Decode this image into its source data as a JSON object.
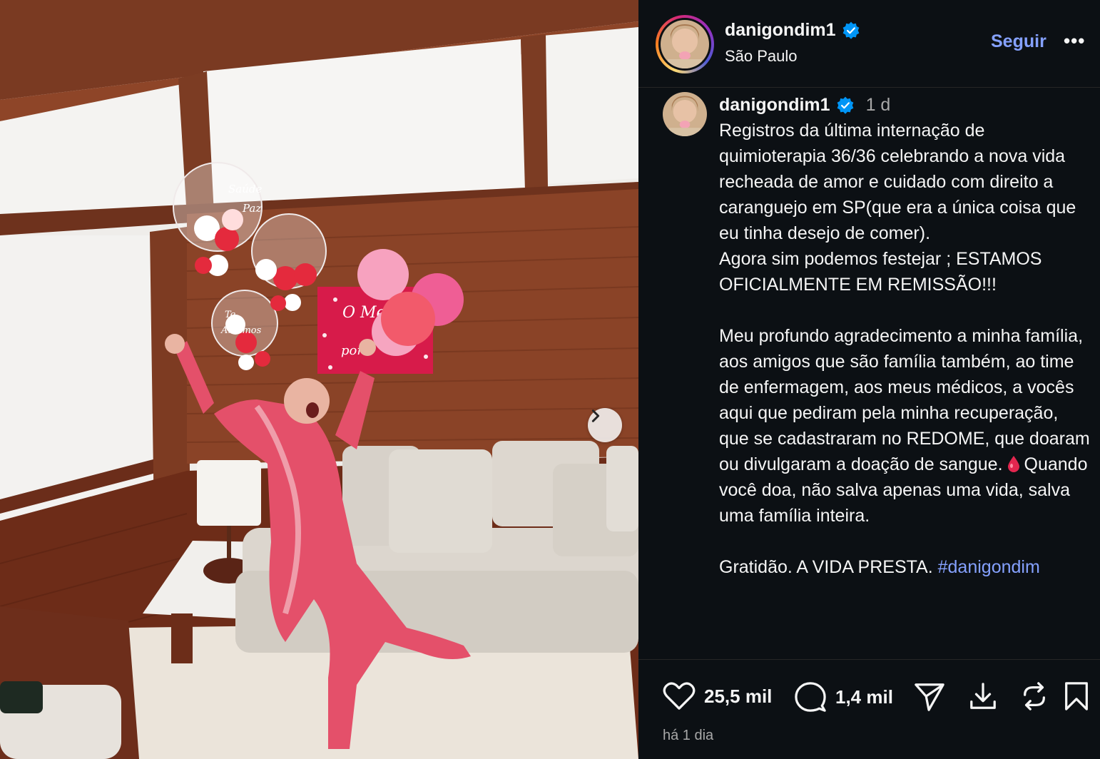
{
  "post": {
    "username": "danigondim1",
    "verified": true,
    "location": "São Paulo",
    "follow_label": "Seguir",
    "more_label": "•••",
    "caption": {
      "username": "danigondim1",
      "time": "1 d",
      "paragraph1": "Registros da última internação de quimioterapia 36/36 celebrando a nova vida recheada de amor e cuidado com direito a caranguejo em SP(que era a única coisa que eu tinha desejo de comer).",
      "paragraph2": "Agora sim podemos festejar ; ESTAMOS OFICIALMENTE EM REMISSÃO!!!",
      "paragraph3_a": "Meu profundo agradecimento a minha família, aos amigos que são família também, ao time de enfermagem, aos meus médicos, a vocês aqui que pediram pela minha recuperação, que se cadastraram no REDOME, que doaram ou divulgaram a doação de sangue.",
      "paragraph3_b": "Quando você doa, não salva apenas uma vida, salva uma família inteira.",
      "closing": "Gratidão. A VIDA PRESTA.",
      "hashtag": "#danigondim"
    },
    "likes": "25,5 mil",
    "comments": "1,4 mil",
    "date": "há 1 dia"
  },
  "photo": {
    "balloon_text_1": "Saúde Paz",
    "balloon_text_2": "Te Amamos",
    "banner_text": "O Meu é por"
  },
  "icons": {
    "verified": "verified-badge-icon",
    "like": "heart-icon",
    "comment": "comment-bubble-icon",
    "share": "paper-plane-icon",
    "save": "bookmark-icon",
    "download": "download-icon",
    "repost": "repost-icon",
    "next": "chevron-right-icon",
    "drop": "blood-drop-icon"
  },
  "colors": {
    "accent": "#85a1ff",
    "verified": "#0095f6",
    "background": "#0c1014"
  }
}
